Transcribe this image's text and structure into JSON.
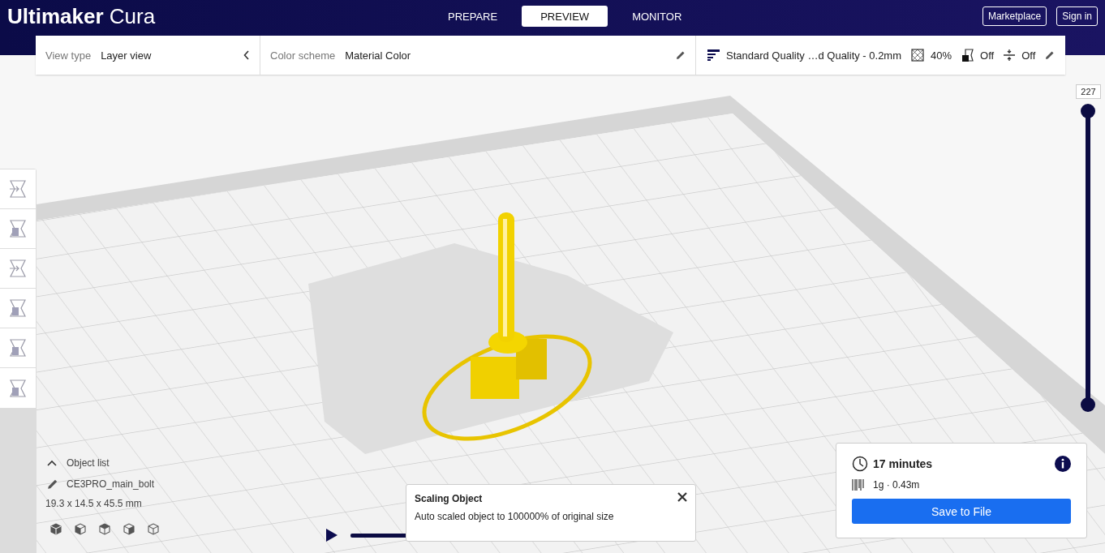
{
  "app": {
    "brand": "Ultimaker",
    "product": "Cura"
  },
  "stages": [
    {
      "label": "PREPARE",
      "selected": false
    },
    {
      "label": "PREVIEW",
      "selected": true
    },
    {
      "label": "MONITOR",
      "selected": false
    }
  ],
  "header_buttons": [
    "Marketplace",
    "Sign in"
  ],
  "view_type": {
    "label": "View type",
    "value": "Layer view"
  },
  "color_scheme": {
    "label": "Color scheme",
    "value": "Material Color"
  },
  "print_setup": {
    "profile": "Standard Quality …d Quality - 0.2mm",
    "infill": "40%",
    "support": "Off",
    "adhesion": "Off"
  },
  "layer_slider": {
    "value": "227",
    "level": 1
  },
  "object_list": {
    "label": "Object list",
    "expanded": false,
    "name": "CE3PRO_main_bolt",
    "dimensions": "19.3 x 14.5 x 45.5 mm"
  },
  "toast": {
    "title": "Scaling Object",
    "message": "Auto scaled object to 100000% of original size"
  },
  "print_info": {
    "time": "17 minutes",
    "material": "1g · 0.43m",
    "button": "Save to File"
  }
}
